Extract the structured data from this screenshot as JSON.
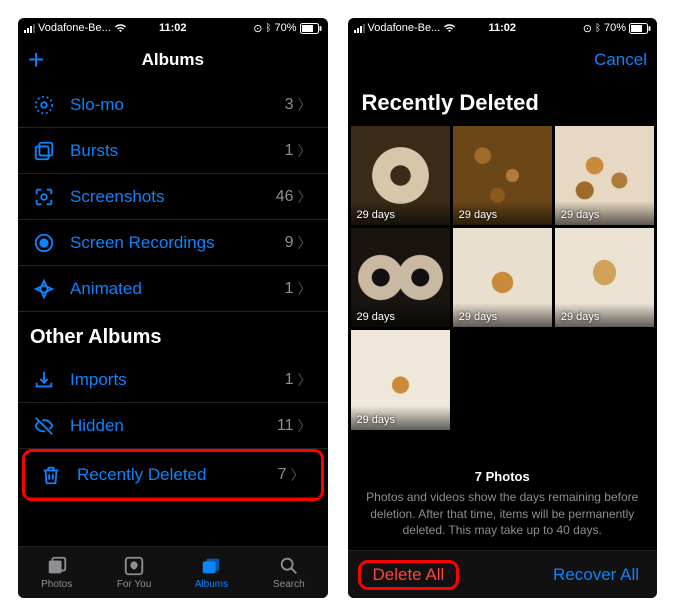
{
  "status": {
    "carrier": "Vodafone-Be...",
    "time": "11:02",
    "battery": "70%"
  },
  "left": {
    "title": "Albums",
    "rows": [
      {
        "icon": "slomo",
        "label": "Slo-mo",
        "count": "3"
      },
      {
        "icon": "bursts",
        "label": "Bursts",
        "count": "1"
      },
      {
        "icon": "screenshots",
        "label": "Screenshots",
        "count": "46"
      },
      {
        "icon": "recordings",
        "label": "Screen Recordings",
        "count": "9"
      },
      {
        "icon": "animated",
        "label": "Animated",
        "count": "1"
      }
    ],
    "section_other": "Other Albums",
    "other_rows": [
      {
        "icon": "imports",
        "label": "Imports",
        "count": "1"
      },
      {
        "icon": "hidden",
        "label": "Hidden",
        "count": "11"
      },
      {
        "icon": "trash",
        "label": "Recently Deleted",
        "count": "7",
        "highlighted": true
      }
    ],
    "tabs": [
      {
        "label": "Photos"
      },
      {
        "label": "For You"
      },
      {
        "label": "Albums",
        "active": true
      },
      {
        "label": "Search"
      }
    ]
  },
  "right": {
    "cancel": "Cancel",
    "title": "Recently Deleted",
    "thumbs": [
      {
        "days": "29 days",
        "cls": "t-donut"
      },
      {
        "days": "29 days",
        "cls": "t-nuts1"
      },
      {
        "days": "29 days",
        "cls": "t-nuts2"
      },
      {
        "days": "29 days",
        "cls": "t-rings"
      },
      {
        "days": "29 days",
        "cls": "t-single"
      },
      {
        "days": "29 days",
        "cls": "t-mush"
      },
      {
        "days": "29 days",
        "cls": "t-small"
      }
    ],
    "info_title": "7 Photos",
    "info_text": "Photos and videos show the days remaining before deletion. After that time, items will be permanently deleted. This may take up to 40 days.",
    "delete_all": "Delete All",
    "recover_all": "Recover All"
  }
}
